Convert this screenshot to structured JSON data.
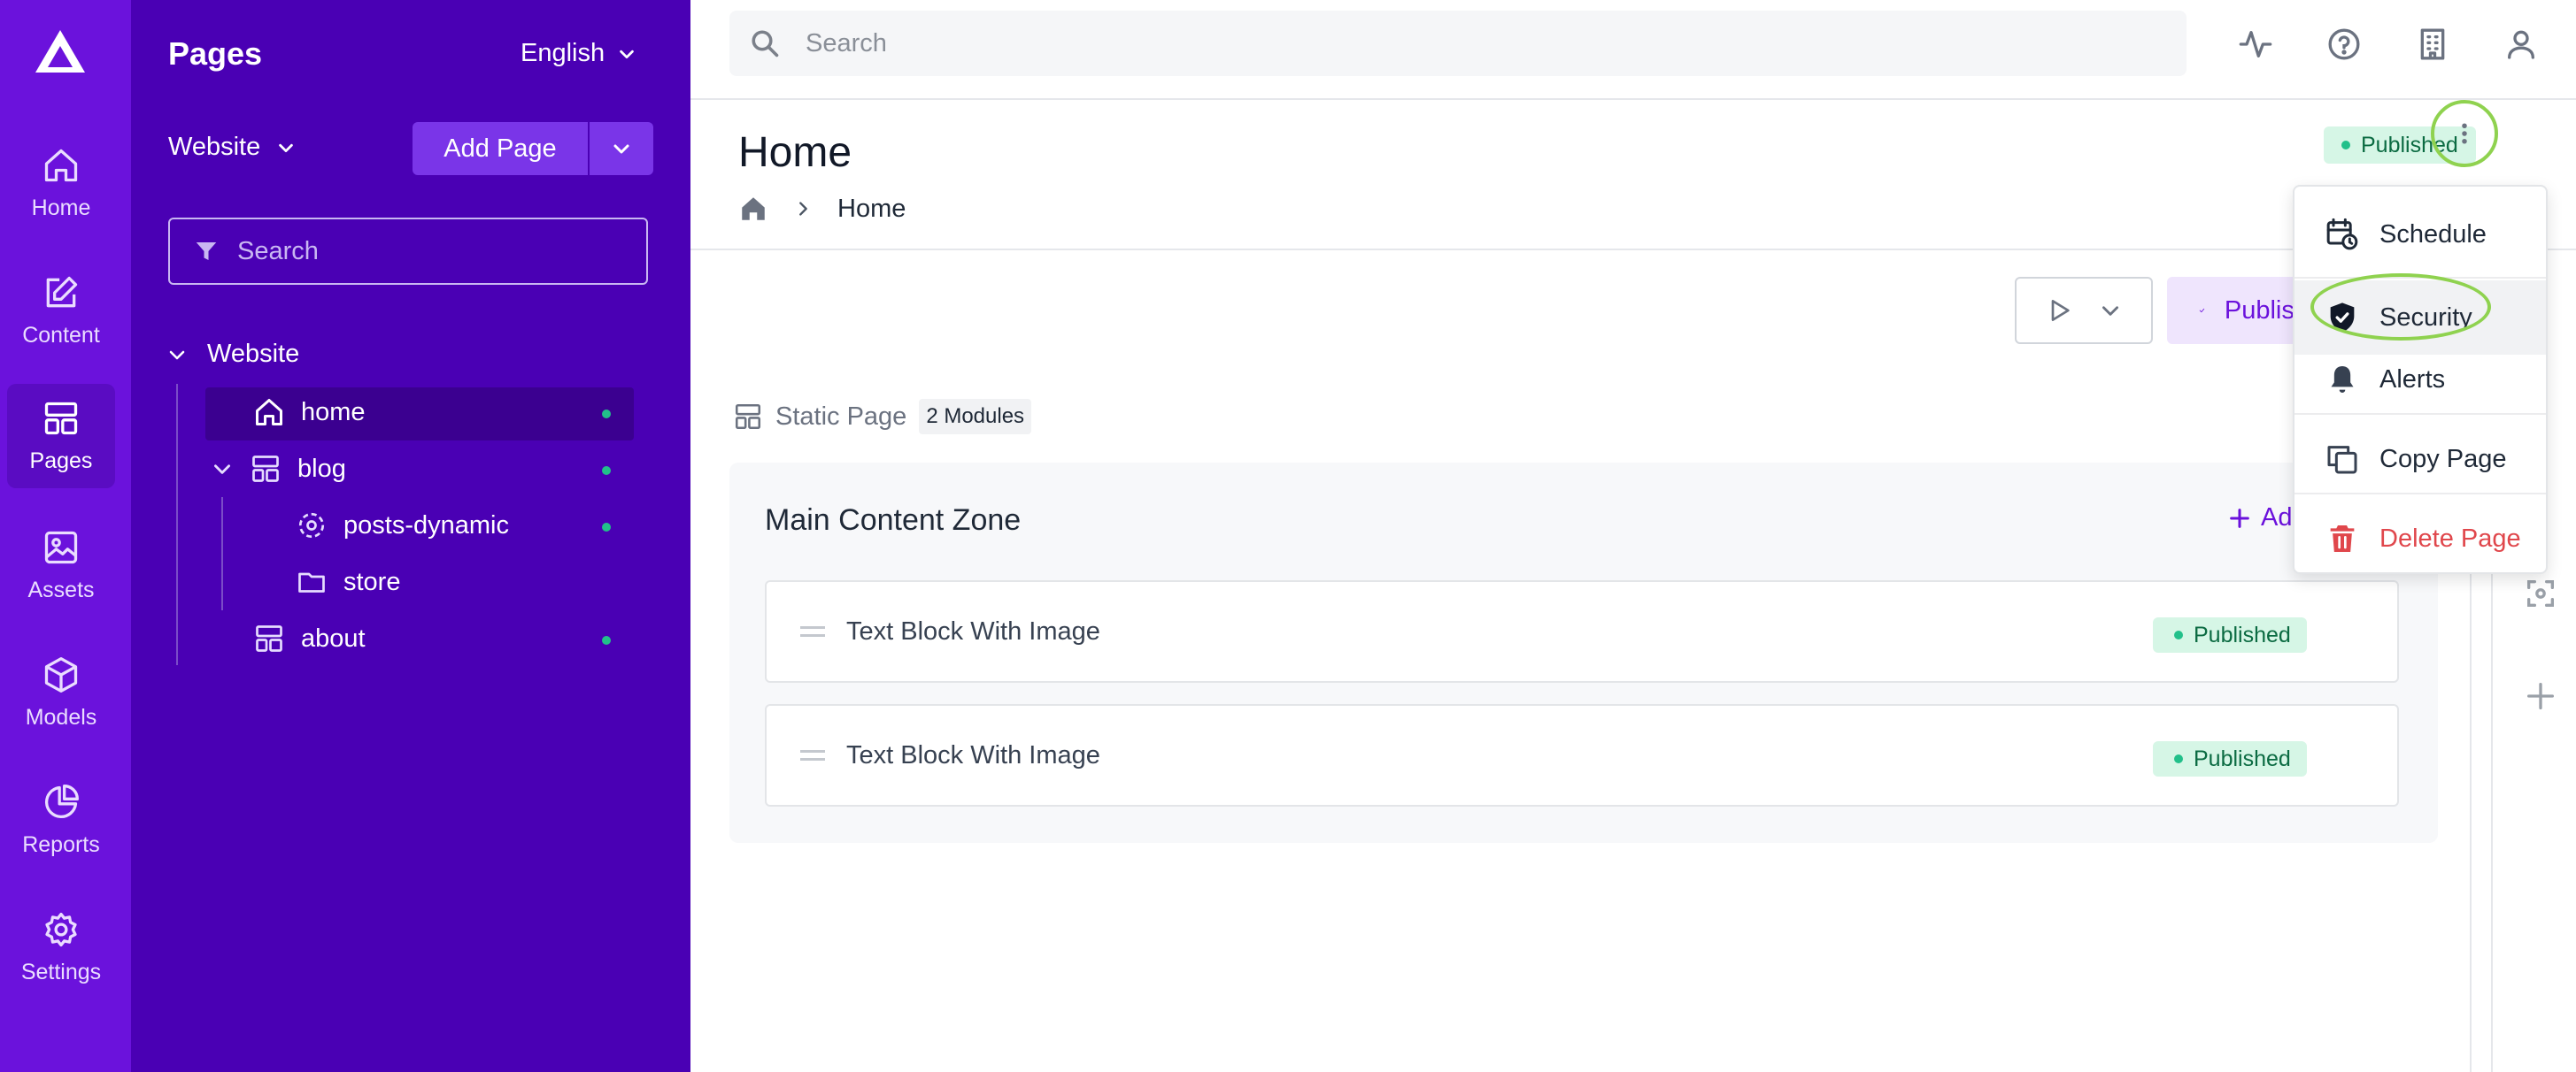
{
  "rail": {
    "items": [
      {
        "label": "Home",
        "icon": "home-icon"
      },
      {
        "label": "Content",
        "icon": "edit-icon"
      },
      {
        "label": "Pages",
        "icon": "layout-icon"
      },
      {
        "label": "Assets",
        "icon": "image-icon"
      },
      {
        "label": "Models",
        "icon": "cube-icon"
      },
      {
        "label": "Reports",
        "icon": "pie-chart-icon"
      },
      {
        "label": "Settings",
        "icon": "gear-icon"
      }
    ],
    "active": "Pages"
  },
  "tree": {
    "title": "Pages",
    "language": "English",
    "site_selector": "Website",
    "add_page_label": "Add Page",
    "search_placeholder": "Search",
    "root": "Website",
    "nodes": [
      {
        "label": "home",
        "icon": "home-icon",
        "published": true,
        "selected": true
      },
      {
        "label": "blog",
        "icon": "layout-icon",
        "published": true,
        "expanded": true
      },
      {
        "label": "posts-dynamic",
        "icon": "dynamic-icon",
        "published": true
      },
      {
        "label": "store",
        "icon": "folder-icon",
        "published": false
      },
      {
        "label": "about",
        "icon": "layout-icon",
        "published": true
      }
    ]
  },
  "topbar": {
    "search_placeholder": "Search",
    "icons": [
      "activity-icon",
      "help-icon",
      "building-icon",
      "user-icon"
    ]
  },
  "header": {
    "title": "Home",
    "breadcrumb": [
      "Home"
    ],
    "status": "Published"
  },
  "toolbar": {
    "publish_label": "Publish"
  },
  "page_meta": {
    "type": "Static Page",
    "modules": "2 Modules"
  },
  "zone": {
    "title": "Main Content Zone",
    "add_label": "Add",
    "modules": [
      {
        "name": "Text Block With Image",
        "status": "Published"
      },
      {
        "name": "Text Block With Image",
        "status": "Published"
      }
    ]
  },
  "menu": {
    "items": [
      {
        "label": "Schedule",
        "icon": "calendar-clock-icon"
      },
      {
        "label": "Security",
        "icon": "shield-icon"
      },
      {
        "label": "Alerts",
        "icon": "bell-icon"
      },
      {
        "label": "Copy Page",
        "icon": "copy-icon"
      },
      {
        "label": "Delete Page",
        "icon": "trash-icon"
      }
    ]
  },
  "colors": {
    "rail": "#6b12dc",
    "tree": "#4a00b4",
    "accent": "#7a35e8",
    "published_bg": "#d6f6e6",
    "published_dot": "#22c08a",
    "danger": "#e0474c",
    "highlight_ring": "#8fd24f"
  }
}
